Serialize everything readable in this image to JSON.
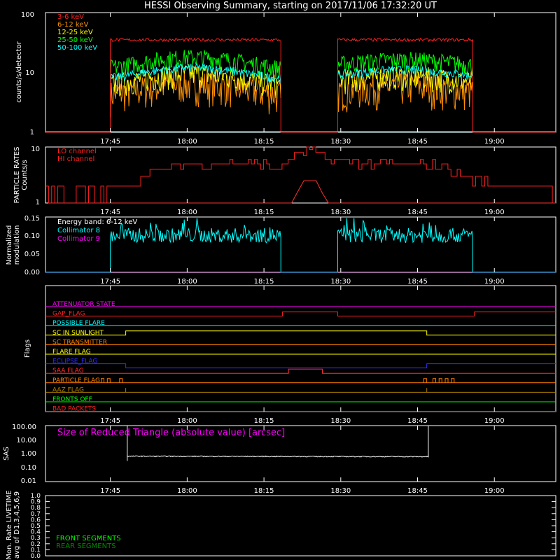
{
  "title": "HESSI Observing Summary, starting on 2017/11/06 17:32:20 UT",
  "time_ticks": [
    "17:45",
    "18:00",
    "18:15",
    "18:30",
    "18:45",
    "19:00"
  ],
  "colors": {
    "3-6": "#ff2020",
    "6-12": "#ff9000",
    "12-25": "#ffff00",
    "25-50": "#00ff00",
    "50-100": "#00ffff",
    "lo": "#ff2020",
    "hi": "#ff3030",
    "col8": "#00ffff",
    "col9": "#ff00ff",
    "energy": "#ffffff"
  },
  "chart_data": [
    {
      "type": "line",
      "ylabel": "counts/s/detector",
      "yscale": "log",
      "ylim": [
        1,
        100
      ],
      "ytick_labels": [
        "1",
        "10",
        "100"
      ],
      "legend": [
        "3-6 keV",
        "6-12 keV",
        "12-25 keV",
        "25-50 keV",
        "50-100 keV"
      ],
      "series": [
        {
          "name": "3-6 keV",
          "values": [
            [
              17.56,
              1
            ],
            [
              17.74,
              1
            ],
            [
              17.75,
              35
            ],
            [
              18.3,
              35
            ],
            [
              18.31,
              1
            ],
            [
              18.48,
              1
            ],
            [
              18.49,
              35
            ],
            [
              18.93,
              35
            ],
            [
              18.94,
              1
            ],
            [
              19.2,
              1
            ]
          ]
        },
        {
          "name": "6-12 keV",
          "values": [
            [
              17.75,
              5
            ],
            [
              17.9,
              6
            ],
            [
              18.0,
              9
            ],
            [
              18.1,
              7
            ],
            [
              18.3,
              5
            ],
            [
              18.49,
              6
            ],
            [
              18.7,
              7
            ],
            [
              18.93,
              6
            ]
          ]
        },
        {
          "name": "12-25 keV",
          "values": [
            [
              17.75,
              7
            ],
            [
              17.9,
              10
            ],
            [
              18.0,
              14
            ],
            [
              18.1,
              12
            ],
            [
              18.3,
              8
            ],
            [
              18.49,
              8
            ],
            [
              18.7,
              10
            ],
            [
              18.93,
              8
            ]
          ]
        },
        {
          "name": "25-50 keV",
          "values": [
            [
              17.75,
              12
            ],
            [
              17.9,
              16
            ],
            [
              18.0,
              22
            ],
            [
              18.1,
              18
            ],
            [
              18.3,
              12
            ],
            [
              18.49,
              13
            ],
            [
              18.7,
              14
            ],
            [
              18.93,
              13
            ]
          ]
        },
        {
          "name": "50-100 keV",
          "values": [
            [
              17.75,
              8
            ],
            [
              17.9,
              12
            ],
            [
              18.0,
              16
            ],
            [
              18.1,
              13
            ],
            [
              18.3,
              9
            ],
            [
              18.49,
              9
            ],
            [
              18.7,
              10
            ],
            [
              18.93,
              9
            ]
          ]
        }
      ]
    },
    {
      "type": "line",
      "ylabel": [
        "PARTICLE RATES",
        "Counts/s"
      ],
      "yscale": "log",
      "ylim": [
        1,
        10
      ],
      "ytick_labels": [
        "1",
        "10"
      ],
      "legend": [
        "LO channel",
        "HI channel"
      ],
      "series": [
        {
          "name": "LO channel",
          "values": [
            [
              17.55,
              1.5
            ],
            [
              17.75,
              1.5
            ],
            [
              17.8,
              2
            ],
            [
              17.85,
              3
            ],
            [
              17.95,
              4.5
            ],
            [
              18.1,
              5
            ],
            [
              18.25,
              5
            ],
            [
              18.3,
              4
            ],
            [
              18.35,
              7
            ],
            [
              18.4,
              9
            ],
            [
              18.45,
              6
            ],
            [
              18.6,
              5
            ],
            [
              18.8,
              5
            ],
            [
              18.9,
              3
            ],
            [
              19.0,
              2
            ],
            [
              19.2,
              1.5
            ]
          ]
        },
        {
          "name": "HI channel",
          "values": [
            [
              17.55,
              1
            ],
            [
              18.34,
              1
            ],
            [
              18.36,
              1.6
            ],
            [
              18.38,
              2.5
            ],
            [
              18.42,
              2.5
            ],
            [
              18.44,
              1.5
            ],
            [
              18.46,
              1
            ],
            [
              19.2,
              1
            ]
          ]
        }
      ]
    },
    {
      "type": "line",
      "ylabel": [
        "Normalized",
        "modulation"
      ],
      "ylim": [
        0,
        0.15
      ],
      "ytick_labels": [
        "0.00",
        "0.05",
        "0.10",
        "0.15"
      ],
      "legend": [
        "Energy band: 6-12 keV",
        "Collimator 8",
        "Collimator 9"
      ],
      "series": [
        {
          "name": "Collimator 8",
          "values": [
            [
              17.75,
              0.1
            ],
            [
              18.31,
              0.1
            ],
            [
              18.49,
              0.1
            ],
            [
              18.93,
              0.1
            ]
          ]
        },
        {
          "name": "Collimator 9",
          "values": [
            [
              17.55,
              0
            ],
            [
              19.2,
              0
            ]
          ]
        }
      ]
    },
    {
      "type": "line",
      "ylabel": "Flags",
      "series": [
        {
          "name": "ATTENUATOR STATE",
          "color": "#ff00ff"
        },
        {
          "name": "GAP_FLAG",
          "color": "#ff2020"
        },
        {
          "name": "POSSIBLE FLARE",
          "color": "#00ffff"
        },
        {
          "name": "SC IN SUNLIGHT",
          "color": "#ffff00"
        },
        {
          "name": "SC TRANSMITTER",
          "color": "#ff8000"
        },
        {
          "name": "FLARE FLAG",
          "color": "#ffff00"
        },
        {
          "name": "ECLIPSE_FLAG",
          "color": "#3030ff"
        },
        {
          "name": "SAA FLAG",
          "color": "#ff3030"
        },
        {
          "name": "PARTICLE FLAG",
          "color": "#ff8000"
        },
        {
          "name": "AAZ FLAG",
          "color": "#b08000"
        },
        {
          "name": "FRONTS OFF",
          "color": "#00ff00"
        },
        {
          "name": "BAD PACKETS",
          "color": "#ff2020"
        }
      ]
    },
    {
      "type": "line",
      "ylabel": "SAS",
      "yscale": "log",
      "ylim": [
        0.01,
        100
      ],
      "ytick_labels": [
        "0.01",
        "0.10",
        "1.00",
        "10.00",
        "100.00"
      ],
      "annotation": "Size of Reduced Triangle (absolute value) [arcsec]",
      "series": [
        {
          "name": "",
          "values": [
            [
              17.8,
              100
            ],
            [
              17.81,
              0.6
            ],
            [
              18.0,
              0.65
            ],
            [
              18.5,
              0.62
            ],
            [
              18.78,
              0.7
            ],
            [
              18.79,
              100
            ]
          ]
        }
      ]
    },
    {
      "type": "line",
      "ylabel": [
        "Mon. Rate LIVETIME",
        "avg of D1,3,4,5,6,9"
      ],
      "ylim": [
        0,
        1
      ],
      "ytick_labels": [
        "0.0",
        "0.1",
        "0.2",
        "0.3",
        "0.4",
        "0.5",
        "0.6",
        "0.7",
        "0.8",
        "0.9",
        "1.0"
      ],
      "legend": [
        "FRONT SEGMENTS",
        "REAR SEGMENTS"
      ]
    }
  ]
}
